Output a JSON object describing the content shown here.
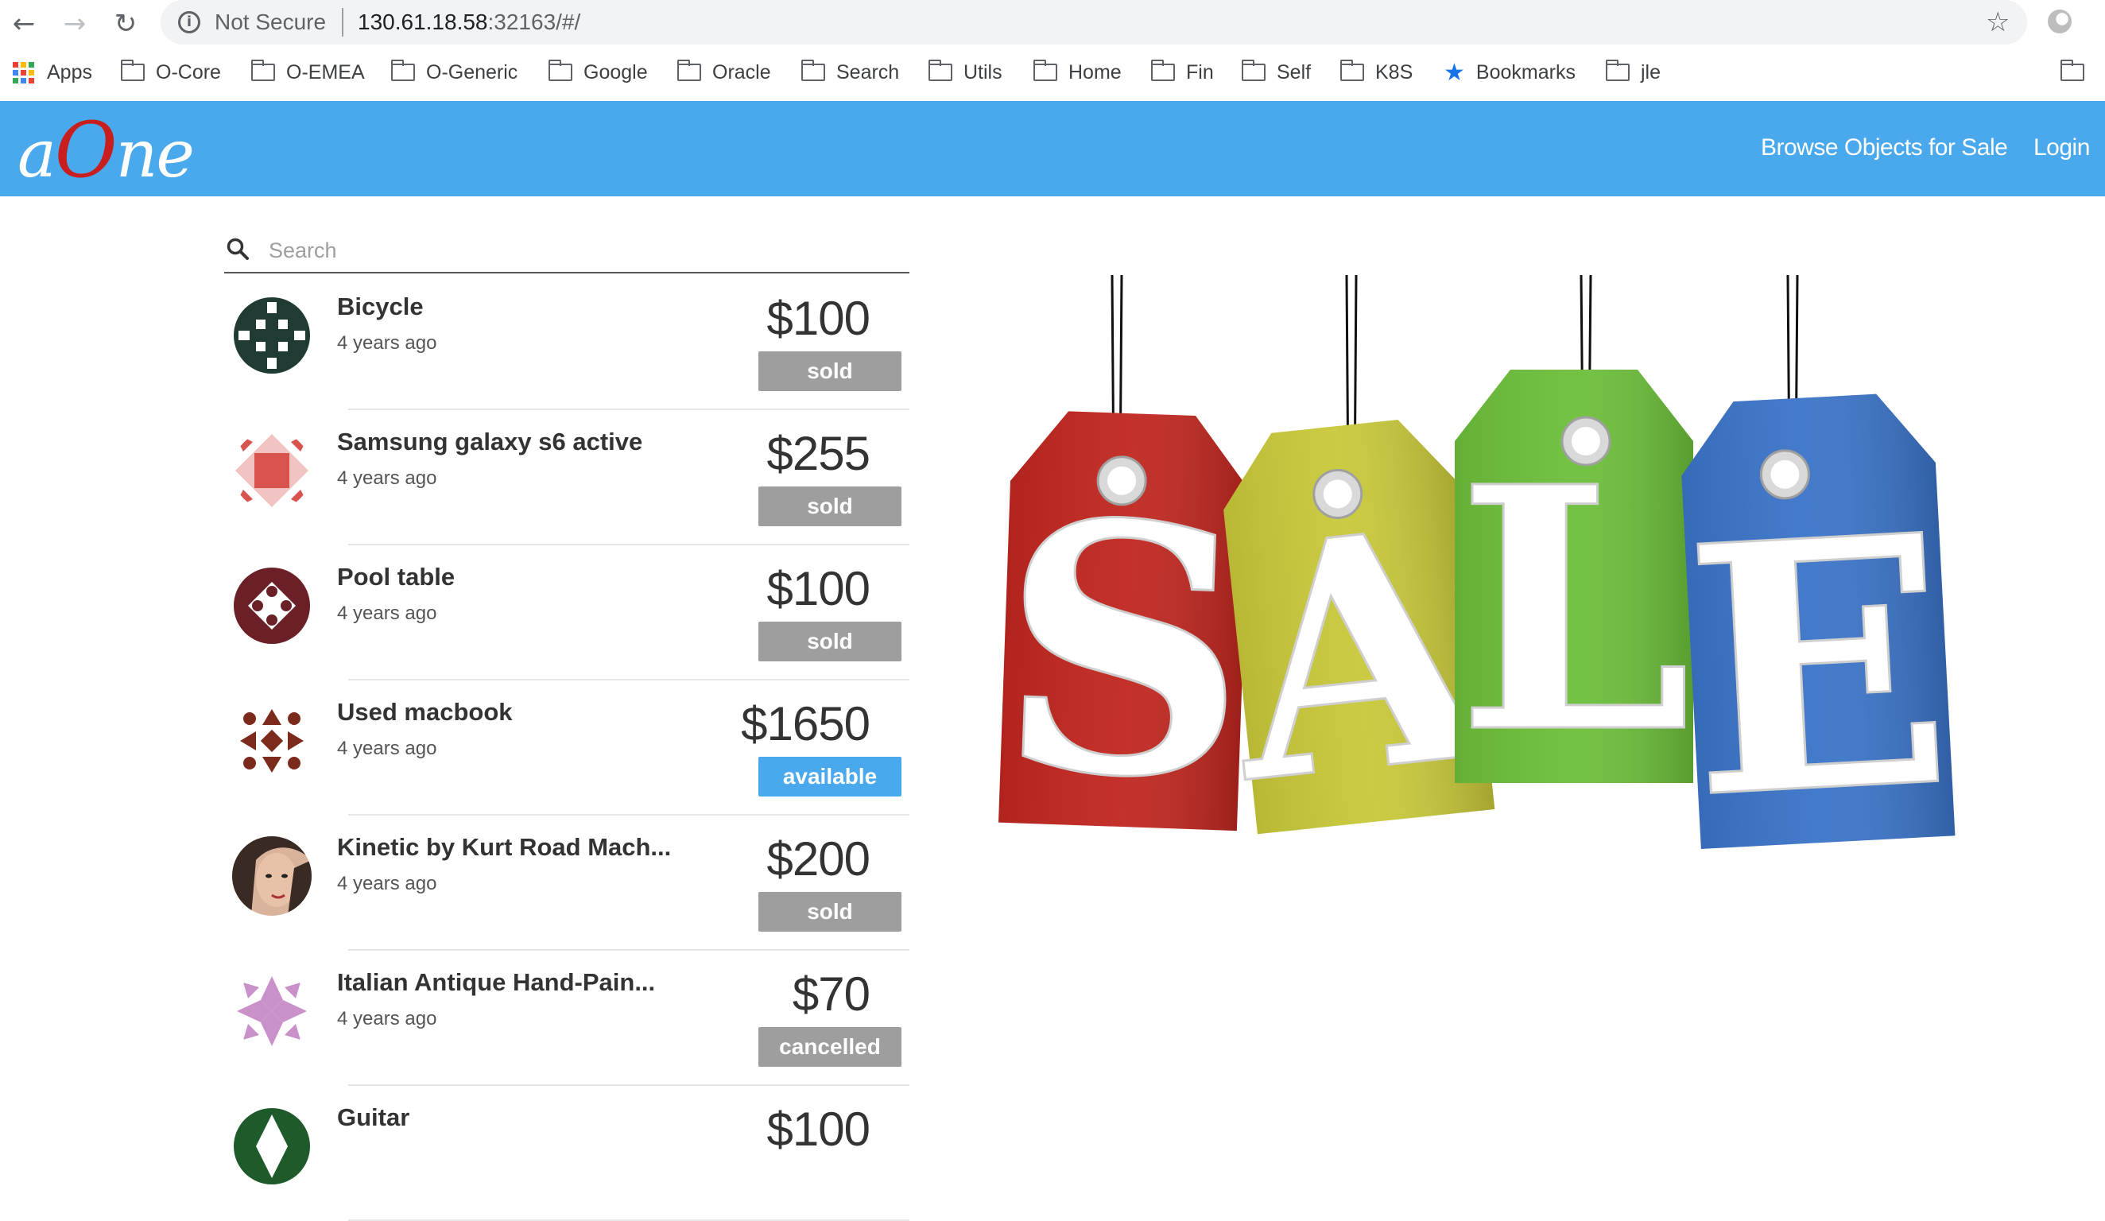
{
  "browser": {
    "security_text": "Not Secure",
    "url_host": "130.61.18.58",
    "url_rest": ":32163/#/",
    "bookmarks": [
      "O-Core",
      "O-EMEA",
      "O-Generic",
      "Google",
      "Oracle",
      "Search",
      "Utils",
      "Home",
      "Fin",
      "Self",
      "K8S"
    ],
    "apps_label": "Apps",
    "bookmarks_label": "Bookmarks",
    "last_folder": "jle"
  },
  "app": {
    "logo_a": "a",
    "logo_o": "O",
    "logo_ne": "ne",
    "nav": {
      "browse": "Browse Objects for Sale",
      "login": "Login"
    },
    "brand_color": "#4aa8ec"
  },
  "search": {
    "placeholder": "Search"
  },
  "items": [
    {
      "title": "Bicycle",
      "time": "4 years ago",
      "price": "$100",
      "status": "sold",
      "avatar_color": "#1f3b34"
    },
    {
      "title": "Samsung galaxy s6 active",
      "time": "4 years ago",
      "price": "$255",
      "status": "sold",
      "avatar_color": "#d9534f"
    },
    {
      "title": "Pool table",
      "time": "4 years ago",
      "price": "$100",
      "status": "sold",
      "avatar_color": "#6b1f27"
    },
    {
      "title": "Used macbook",
      "time": "4 years ago",
      "price": "$1650",
      "status": "available",
      "avatar_color": "#7b2a1b"
    },
    {
      "title": "Kinetic by Kurt Road Mach...",
      "time": "4 years ago",
      "price": "$200",
      "status": "sold",
      "avatar_color": "#3a2a24"
    },
    {
      "title": "Italian Antique Hand-Pain...",
      "time": "4 years ago",
      "price": "$70",
      "status": "cancelled",
      "avatar_color": "#c990c9"
    },
    {
      "title": "Guitar",
      "time": "",
      "price": "$100",
      "status": "",
      "avatar_color": "#1f5a2a"
    }
  ],
  "sale_image": {
    "letters": [
      "S",
      "A",
      "L",
      "E"
    ],
    "colors": [
      "#c0261f",
      "#c8c83a",
      "#6cbf3a",
      "#3b74c8"
    ]
  }
}
